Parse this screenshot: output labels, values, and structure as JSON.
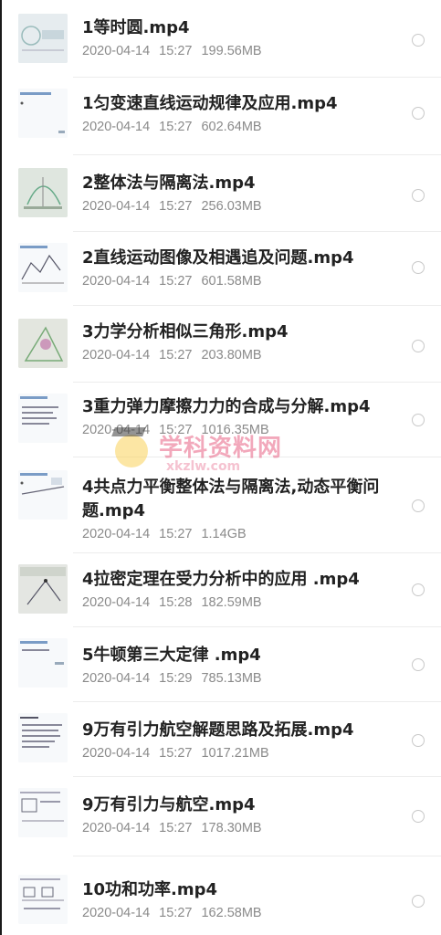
{
  "files": [
    {
      "name": "1等时圆.mp4",
      "date": "2020-04-14",
      "time": "15:27",
      "size": "199.56MB"
    },
    {
      "name": "1匀变速直线运动规律及应用.mp4",
      "date": "2020-04-14",
      "time": "15:27",
      "size": "602.64MB"
    },
    {
      "name": "2整体法与隔离法.mp4",
      "date": "2020-04-14",
      "time": "15:27",
      "size": "256.03MB"
    },
    {
      "name": "2直线运动图像及相遇追及问题.mp4",
      "date": "2020-04-14",
      "time": "15:27",
      "size": "601.58MB"
    },
    {
      "name": "3力学分析相似三角形.mp4",
      "date": "2020-04-14",
      "time": "15:27",
      "size": "203.80MB"
    },
    {
      "name": "3重力弹力摩擦力力的合成与分解.mp4",
      "date": "2020-04-14",
      "time": "15:27",
      "size": "1016.35MB"
    },
    {
      "name": "4共点力平衡整体法与隔离法,动态平衡问题.mp4",
      "date": "2020-04-14",
      "time": "15:27",
      "size": "1.14GB"
    },
    {
      "name": "4拉密定理在受力分析中的应用 .mp4",
      "date": "2020-04-14",
      "time": "15:28",
      "size": "182.59MB"
    },
    {
      "name": "5牛顿第三大定律 .mp4",
      "date": "2020-04-14",
      "time": "15:29",
      "size": "785.13MB"
    },
    {
      "name": "9万有引力航空解题思路及拓展.mp4",
      "date": "2020-04-14",
      "time": "15:27",
      "size": "1017.21MB"
    },
    {
      "name": "9万有引力与航空.mp4",
      "date": "2020-04-14",
      "time": "15:27",
      "size": "178.30MB"
    },
    {
      "name": "10功和功率.mp4",
      "date": "2020-04-14",
      "time": "15:27",
      "size": "162.58MB"
    }
  ],
  "watermark": {
    "title": "学科资料网",
    "url": "xkzlw.com"
  }
}
